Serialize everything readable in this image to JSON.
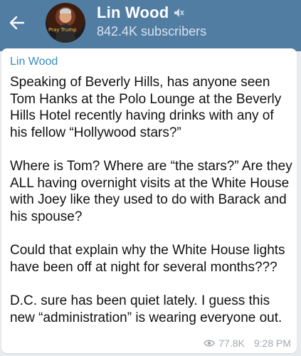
{
  "header": {
    "title": "Lin Wood",
    "subtitle": "842.4K subscribers",
    "avatar_text": "Pray Trump"
  },
  "message": {
    "sender": "Lin Wood",
    "paragraphs": [
      "Speaking of Beverly Hills, has anyone seen Tom Hanks at the Polo Lounge at the Beverly Hills Hotel recently having drinks with any of his fellow “Hollywood stars?”",
      "Where is Tom? Where are “the stars?” Are they ALL having overnight visits at the White House with Joey like they used to do with Barack and his spouse?",
      "Could that explain why the White House lights have been off at night for several months???",
      "D.C. sure has been quiet lately. I guess this new “administration” is wearing everyone out."
    ],
    "views": "77.8K",
    "time": "9:28 PM"
  },
  "colors": {
    "header_bg": "#527da3",
    "sender": "#3a8cc0",
    "meta": "#a3a9b0"
  },
  "icons": {
    "back": "arrow-left-icon",
    "mute": "muted-speaker-icon",
    "views": "eye-icon"
  }
}
